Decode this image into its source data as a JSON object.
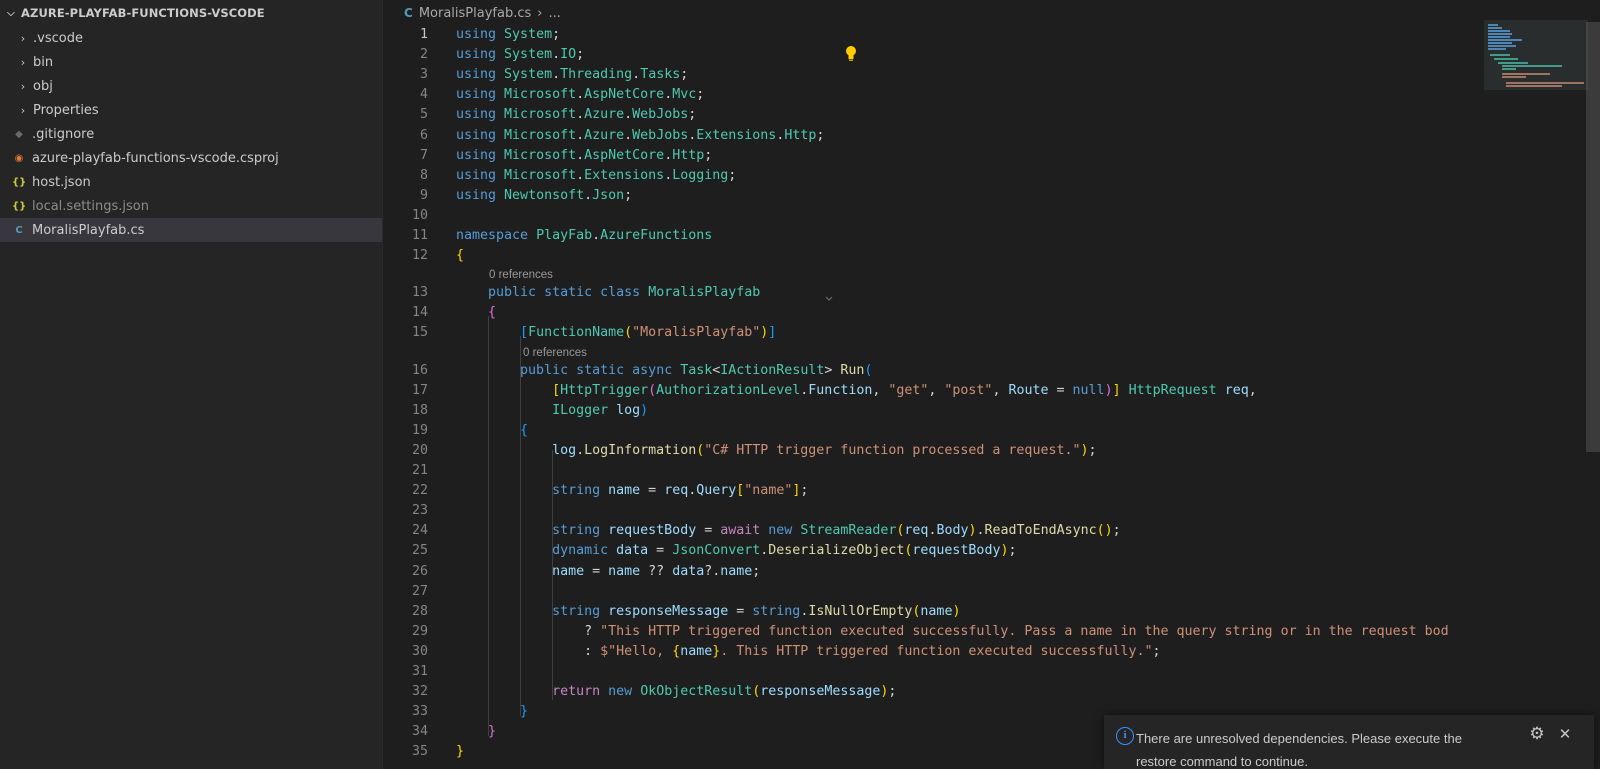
{
  "explorer": {
    "title": "AZURE-PLAYFAB-FUNCTIONS-VSCODE",
    "items": [
      {
        "label": ".vscode",
        "kind": "folder"
      },
      {
        "label": "bin",
        "kind": "folder"
      },
      {
        "label": "obj",
        "kind": "folder"
      },
      {
        "label": "Properties",
        "kind": "folder"
      },
      {
        "label": ".gitignore",
        "kind": "file",
        "icon": "git-icon"
      },
      {
        "label": "azure-playfab-functions-vscode.csproj",
        "kind": "file",
        "icon": "rss-icon"
      },
      {
        "label": "host.json",
        "kind": "file",
        "icon": "json-icon"
      },
      {
        "label": "local.settings.json",
        "kind": "file",
        "icon": "json-icon"
      },
      {
        "label": "MoralisPlayfab.cs",
        "kind": "file",
        "icon": "csharp-icon",
        "selected": true
      }
    ]
  },
  "breadcrumb": {
    "file": "MoralisPlayfab.cs",
    "ellipsis": "..."
  },
  "editor": {
    "codelens": [
      "0 references",
      "0 references"
    ],
    "lines": [
      {
        "n": "1",
        "tokens": [
          [
            "kw",
            "using"
          ],
          [
            "pl",
            " "
          ],
          [
            "ty",
            "System"
          ],
          [
            "pl",
            ";"
          ]
        ]
      },
      {
        "n": "2",
        "tokens": [
          [
            "kw",
            "using"
          ],
          [
            "pl",
            " "
          ],
          [
            "ty",
            "System"
          ],
          [
            "pl",
            "."
          ],
          [
            "ty",
            "IO"
          ],
          [
            "pl",
            ";"
          ]
        ]
      },
      {
        "n": "3",
        "tokens": [
          [
            "kw",
            "using"
          ],
          [
            "pl",
            " "
          ],
          [
            "ty",
            "System"
          ],
          [
            "pl",
            "."
          ],
          [
            "ty",
            "Threading"
          ],
          [
            "pl",
            "."
          ],
          [
            "ty",
            "Tasks"
          ],
          [
            "pl",
            ";"
          ]
        ]
      },
      {
        "n": "4",
        "tokens": [
          [
            "kw",
            "using"
          ],
          [
            "pl",
            " "
          ],
          [
            "ty",
            "Microsoft"
          ],
          [
            "pl",
            "."
          ],
          [
            "ty",
            "AspNetCore"
          ],
          [
            "pl",
            "."
          ],
          [
            "ty",
            "Mvc"
          ],
          [
            "pl",
            ";"
          ]
        ]
      },
      {
        "n": "5",
        "tokens": [
          [
            "kw",
            "using"
          ],
          [
            "pl",
            " "
          ],
          [
            "ty",
            "Microsoft"
          ],
          [
            "pl",
            "."
          ],
          [
            "ty",
            "Azure"
          ],
          [
            "pl",
            "."
          ],
          [
            "ty",
            "WebJobs"
          ],
          [
            "pl",
            ";"
          ]
        ]
      },
      {
        "n": "6",
        "tokens": [
          [
            "kw",
            "using"
          ],
          [
            "pl",
            " "
          ],
          [
            "ty",
            "Microsoft"
          ],
          [
            "pl",
            "."
          ],
          [
            "ty",
            "Azure"
          ],
          [
            "pl",
            "."
          ],
          [
            "ty",
            "WebJobs"
          ],
          [
            "pl",
            "."
          ],
          [
            "ty",
            "Extensions"
          ],
          [
            "pl",
            "."
          ],
          [
            "ty",
            "Http"
          ],
          [
            "pl",
            ";"
          ]
        ]
      },
      {
        "n": "7",
        "tokens": [
          [
            "kw",
            "using"
          ],
          [
            "pl",
            " "
          ],
          [
            "ty",
            "Microsoft"
          ],
          [
            "pl",
            "."
          ],
          [
            "ty",
            "AspNetCore"
          ],
          [
            "pl",
            "."
          ],
          [
            "ty",
            "Http"
          ],
          [
            "pl",
            ";"
          ]
        ]
      },
      {
        "n": "8",
        "tokens": [
          [
            "kw",
            "using"
          ],
          [
            "pl",
            " "
          ],
          [
            "ty",
            "Microsoft"
          ],
          [
            "pl",
            "."
          ],
          [
            "ty",
            "Extensions"
          ],
          [
            "pl",
            "."
          ],
          [
            "ty",
            "Logging"
          ],
          [
            "pl",
            ";"
          ]
        ]
      },
      {
        "n": "9",
        "tokens": [
          [
            "kw",
            "using"
          ],
          [
            "pl",
            " "
          ],
          [
            "ty",
            "Newtonsoft"
          ],
          [
            "pl",
            "."
          ],
          [
            "ty",
            "Json"
          ],
          [
            "pl",
            ";"
          ]
        ]
      },
      {
        "n": "10",
        "tokens": []
      },
      {
        "n": "11",
        "tokens": [
          [
            "kw",
            "namespace"
          ],
          [
            "pl",
            " "
          ],
          [
            "ty",
            "PlayFab"
          ],
          [
            "pl",
            "."
          ],
          [
            "ty",
            "AzureFunctions"
          ]
        ]
      },
      {
        "n": "12",
        "tokens": [
          [
            "br1",
            "{"
          ]
        ]
      },
      {
        "n": "13",
        "tokens": [
          [
            "pl",
            "    "
          ],
          [
            "kw",
            "public"
          ],
          [
            "pl",
            " "
          ],
          [
            "kw",
            "static"
          ],
          [
            "pl",
            " "
          ],
          [
            "kw",
            "class"
          ],
          [
            "pl",
            " "
          ],
          [
            "ty",
            "MoralisPlayfab"
          ]
        ]
      },
      {
        "n": "14",
        "tokens": [
          [
            "pl",
            "    "
          ],
          [
            "br2",
            "{"
          ]
        ]
      },
      {
        "n": "15",
        "tokens": [
          [
            "pl",
            "        "
          ],
          [
            "br3",
            "["
          ],
          [
            "ty",
            "FunctionName"
          ],
          [
            "br1",
            "("
          ],
          [
            "st",
            "\"MoralisPlayfab\""
          ],
          [
            "br1",
            ")"
          ],
          [
            "br3",
            "]"
          ]
        ]
      },
      {
        "n": "16",
        "tokens": [
          [
            "pl",
            "        "
          ],
          [
            "kw",
            "public"
          ],
          [
            "pl",
            " "
          ],
          [
            "kw",
            "static"
          ],
          [
            "pl",
            " "
          ],
          [
            "kw",
            "async"
          ],
          [
            "pl",
            " "
          ],
          [
            "ty",
            "Task"
          ],
          [
            "pl",
            "<"
          ],
          [
            "ty",
            "IActionResult"
          ],
          [
            "pl",
            "> "
          ],
          [
            "fn",
            "Run"
          ],
          [
            "br3",
            "("
          ]
        ]
      },
      {
        "n": "17",
        "tokens": [
          [
            "pl",
            "            "
          ],
          [
            "br1",
            "["
          ],
          [
            "ty",
            "HttpTrigger"
          ],
          [
            "br2",
            "("
          ],
          [
            "ty",
            "AuthorizationLevel"
          ],
          [
            "pl",
            "."
          ],
          [
            "va",
            "Function"
          ],
          [
            "pl",
            ", "
          ],
          [
            "st",
            "\"get\""
          ],
          [
            "pl",
            ", "
          ],
          [
            "st",
            "\"post\""
          ],
          [
            "pl",
            ", "
          ],
          [
            "va",
            "Route"
          ],
          [
            "pl",
            " = "
          ],
          [
            "kw",
            "null"
          ],
          [
            "br2",
            ")"
          ],
          [
            "br1",
            "]"
          ],
          [
            "pl",
            " "
          ],
          [
            "ty",
            "HttpRequest"
          ],
          [
            "pl",
            " "
          ],
          [
            "va",
            "req"
          ],
          [
            "pl",
            ","
          ]
        ]
      },
      {
        "n": "18",
        "tokens": [
          [
            "pl",
            "            "
          ],
          [
            "ty",
            "ILogger"
          ],
          [
            "pl",
            " "
          ],
          [
            "va",
            "log"
          ],
          [
            "br3",
            ")"
          ]
        ]
      },
      {
        "n": "19",
        "tokens": [
          [
            "pl",
            "        "
          ],
          [
            "br3",
            "{"
          ]
        ]
      },
      {
        "n": "20",
        "tokens": [
          [
            "pl",
            "            "
          ],
          [
            "va",
            "log"
          ],
          [
            "pl",
            "."
          ],
          [
            "fn",
            "LogInformation"
          ],
          [
            "br1",
            "("
          ],
          [
            "st",
            "\"C# HTTP trigger function processed a request.\""
          ],
          [
            "br1",
            ")"
          ],
          [
            "pl",
            ";"
          ]
        ]
      },
      {
        "n": "21",
        "tokens": []
      },
      {
        "n": "22",
        "tokens": [
          [
            "pl",
            "            "
          ],
          [
            "kw",
            "string"
          ],
          [
            "pl",
            " "
          ],
          [
            "va",
            "name"
          ],
          [
            "pl",
            " = "
          ],
          [
            "va",
            "req"
          ],
          [
            "pl",
            "."
          ],
          [
            "va",
            "Query"
          ],
          [
            "br1",
            "["
          ],
          [
            "st",
            "\"name\""
          ],
          [
            "br1",
            "]"
          ],
          [
            "pl",
            ";"
          ]
        ]
      },
      {
        "n": "23",
        "tokens": []
      },
      {
        "n": "24",
        "tokens": [
          [
            "pl",
            "            "
          ],
          [
            "kw",
            "string"
          ],
          [
            "pl",
            " "
          ],
          [
            "va",
            "requestBody"
          ],
          [
            "pl",
            " = "
          ],
          [
            "ctl",
            "await"
          ],
          [
            "pl",
            " "
          ],
          [
            "kw",
            "new"
          ],
          [
            "pl",
            " "
          ],
          [
            "ty",
            "StreamReader"
          ],
          [
            "br1",
            "("
          ],
          [
            "va",
            "req"
          ],
          [
            "pl",
            "."
          ],
          [
            "va",
            "Body"
          ],
          [
            "br1",
            ")"
          ],
          [
            "pl",
            "."
          ],
          [
            "fn",
            "ReadToEndAsync"
          ],
          [
            "br1",
            "()"
          ],
          [
            "pl",
            ";"
          ]
        ]
      },
      {
        "n": "25",
        "tokens": [
          [
            "pl",
            "            "
          ],
          [
            "kw",
            "dynamic"
          ],
          [
            "pl",
            " "
          ],
          [
            "va",
            "data"
          ],
          [
            "pl",
            " = "
          ],
          [
            "ty",
            "JsonConvert"
          ],
          [
            "pl",
            "."
          ],
          [
            "fn",
            "DeserializeObject"
          ],
          [
            "br1",
            "("
          ],
          [
            "va",
            "requestBody"
          ],
          [
            "br1",
            ")"
          ],
          [
            "pl",
            ";"
          ]
        ]
      },
      {
        "n": "26",
        "tokens": [
          [
            "pl",
            "            "
          ],
          [
            "va",
            "name"
          ],
          [
            "pl",
            " = "
          ],
          [
            "va",
            "name"
          ],
          [
            "pl",
            " ?? "
          ],
          [
            "va",
            "data"
          ],
          [
            "pl",
            "?."
          ],
          [
            "va",
            "name"
          ],
          [
            "pl",
            ";"
          ]
        ]
      },
      {
        "n": "27",
        "tokens": []
      },
      {
        "n": "28",
        "tokens": [
          [
            "pl",
            "            "
          ],
          [
            "kw",
            "string"
          ],
          [
            "pl",
            " "
          ],
          [
            "va",
            "responseMessage"
          ],
          [
            "pl",
            " = "
          ],
          [
            "kw",
            "string"
          ],
          [
            "pl",
            "."
          ],
          [
            "fn",
            "IsNullOrEmpty"
          ],
          [
            "br1",
            "("
          ],
          [
            "va",
            "name"
          ],
          [
            "br1",
            ")"
          ]
        ]
      },
      {
        "n": "29",
        "tokens": [
          [
            "pl",
            "                ? "
          ],
          [
            "st",
            "\"This HTTP triggered function executed successfully. Pass a name in the query string or in the request bod"
          ]
        ]
      },
      {
        "n": "30",
        "tokens": [
          [
            "pl",
            "                : "
          ],
          [
            "st",
            "$\"Hello, "
          ],
          [
            "br1",
            "{"
          ],
          [
            "va",
            "name"
          ],
          [
            "br1",
            "}"
          ],
          [
            "st",
            ". This HTTP triggered function executed successfully.\""
          ],
          [
            "pl",
            ";"
          ]
        ]
      },
      {
        "n": "31",
        "tokens": []
      },
      {
        "n": "32",
        "tokens": [
          [
            "pl",
            "            "
          ],
          [
            "ctl",
            "return"
          ],
          [
            "pl",
            " "
          ],
          [
            "kw",
            "new"
          ],
          [
            "pl",
            " "
          ],
          [
            "ty",
            "OkObjectResult"
          ],
          [
            "br1",
            "("
          ],
          [
            "va",
            "responseMessage"
          ],
          [
            "br1",
            ")"
          ],
          [
            "pl",
            ";"
          ]
        ]
      },
      {
        "n": "33",
        "tokens": [
          [
            "pl",
            "        "
          ],
          [
            "br3",
            "}"
          ]
        ]
      },
      {
        "n": "34",
        "tokens": [
          [
            "pl",
            "    "
          ],
          [
            "br2",
            "}"
          ]
        ]
      },
      {
        "n": "35",
        "tokens": [
          [
            "br1",
            "}"
          ]
        ]
      }
    ]
  },
  "notification": {
    "message": "There are unresolved dependencies. Please execute the restore command to continue.",
    "icon": "info-icon",
    "gear": "⚙",
    "close": "✕"
  },
  "colors": {
    "background": "#1e1e1e",
    "sidebar": "#252526",
    "selection": "#37373d",
    "keyword": "#569cd6",
    "type": "#4ec9b0",
    "string": "#ce9178",
    "function": "#dcdcaa",
    "variable": "#9cdcfe",
    "info": "#3794ff"
  }
}
